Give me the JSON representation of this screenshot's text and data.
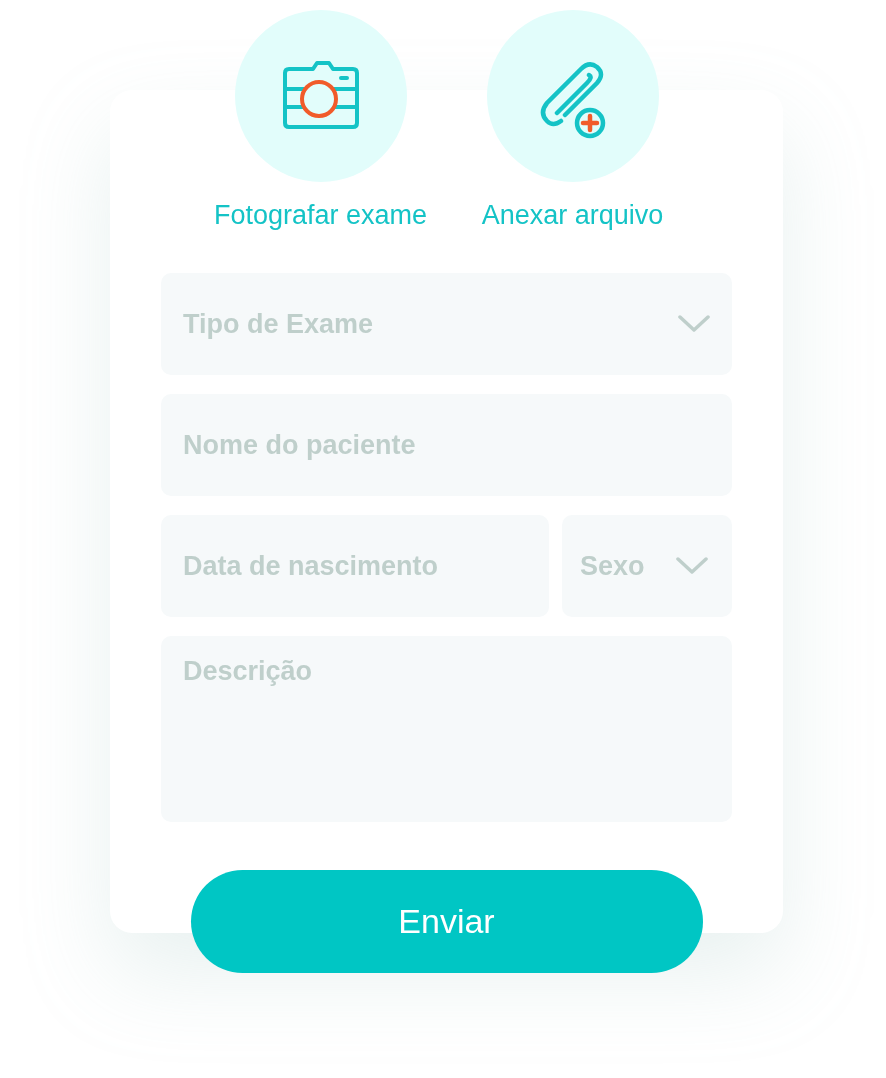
{
  "actions": [
    {
      "kind": "camera",
      "label": "Fotografar exame"
    },
    {
      "kind": "attach",
      "label": "Anexar arquivo"
    }
  ],
  "form_rows": [
    {
      "fields": [
        {
          "kind": "select",
          "placeholder": "Tipo de Exame"
        }
      ]
    },
    {
      "fields": [
        {
          "kind": "input",
          "placeholder": "Nome do paciente"
        }
      ]
    },
    {
      "fields": [
        {
          "kind": "input",
          "placeholder": "Data de nascimento"
        },
        {
          "kind": "select",
          "placeholder": "Sexo"
        }
      ]
    },
    {
      "fields": [
        {
          "kind": "textarea",
          "placeholder": "Descrição"
        }
      ]
    }
  ],
  "submit": {
    "label": "Enviar"
  }
}
